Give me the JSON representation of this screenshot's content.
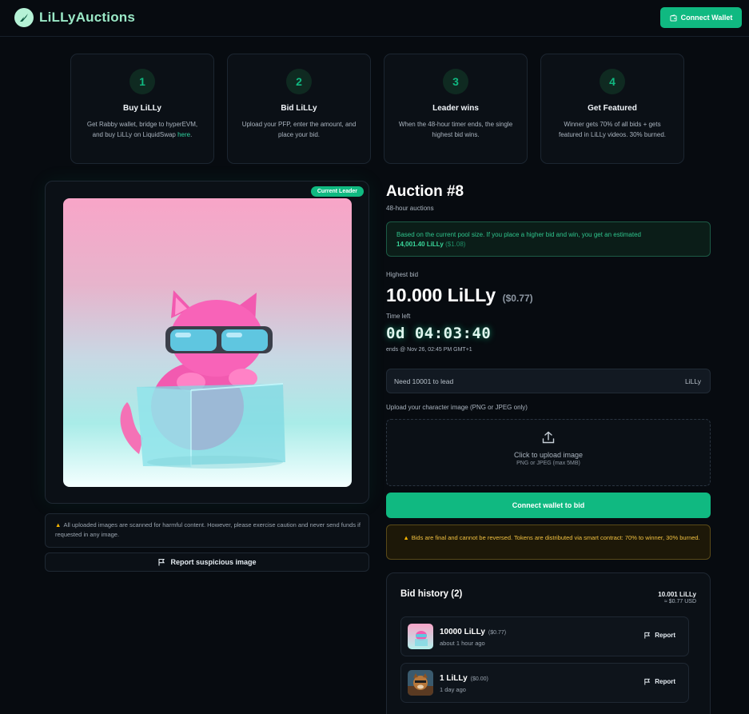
{
  "header": {
    "brand": "LiLLyAuctions",
    "connect_label": "Connect Wallet"
  },
  "steps": [
    {
      "num": "1",
      "title": "Buy LiLLy",
      "desc": "Get Rabby wallet, bridge to hyperEVM, and buy LiLLy on LiquidSwap ",
      "link": "here",
      "after": "."
    },
    {
      "num": "2",
      "title": "Bid LiLLy",
      "desc": "Upload your PFP, enter the amount, and place your bid."
    },
    {
      "num": "3",
      "title": "Leader wins",
      "desc": "When the 48-hour timer ends, the single highest bid wins."
    },
    {
      "num": "4",
      "title": "Get Featured",
      "desc": "Winner gets 70% of all bids + gets featured in LiLLy videos. 30% burned."
    }
  ],
  "left": {
    "badge": "Current Leader",
    "warning": "All uploaded images are scanned for harmful content. However, please exercise caution and never send funds if requested in any image.",
    "report_label": "Report suspicious image"
  },
  "auction": {
    "title": "Auction #8",
    "subtitle": "48-hour auctions",
    "estimate_pre": "Based on the current pool size. If you place a higher bid and win, you get an estimated",
    "estimate_amount": "14,001.40 LiLLy",
    "estimate_usd": "($1.08)",
    "highest_label": "Highest bid",
    "highest_value": "10.000 LiLLy",
    "highest_usd": "($0.77)",
    "time_label": "Time left",
    "timer": "0d 04:03:40",
    "ends": "ends @ Nov 26, 02:45 PM GMT+1",
    "input_placeholder": "Need 10001 to lead",
    "input_unit": "LiLLy",
    "upload_label": "Upload your character image (PNG or JPEG only)",
    "upload_main": "Click to upload image",
    "upload_sub": "PNG or JPEG (max 5MB)",
    "bid_button": "Connect wallet to bid",
    "final_notice": "Bids are final and cannot be reversed. Tokens are distributed via smart contract: 70% to winner, 30% burned."
  },
  "history": {
    "title": "Bid history (2)",
    "total": "10.001 LiLLy",
    "total_usd": "≈ $0.77 USD",
    "rows": [
      {
        "amount": "10000 LiLLy",
        "usd": "($0.77)",
        "time": "about 1 hour ago",
        "report": "Report"
      },
      {
        "amount": "1 LiLLy",
        "usd": "($0.00)",
        "time": "1 day ago",
        "report": "Report"
      }
    ]
  },
  "colors": {
    "accent": "#10b981",
    "background": "#070b10",
    "warning": "#f0c040"
  }
}
